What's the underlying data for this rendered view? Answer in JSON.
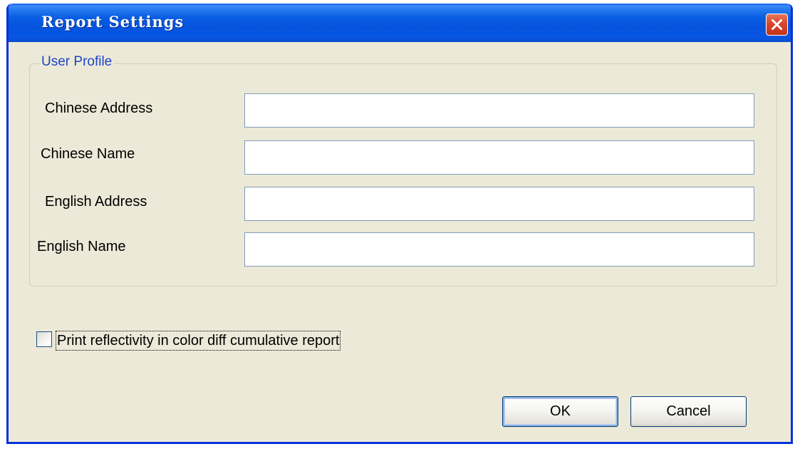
{
  "window": {
    "title": "Report Settings"
  },
  "group": {
    "legend": "User Profile",
    "fields": [
      {
        "label": "Chinese Address",
        "value": ""
      },
      {
        "label": "Chinese Name",
        "value": ""
      },
      {
        "label": "English Address",
        "value": ""
      },
      {
        "label": "English Name",
        "value": ""
      }
    ]
  },
  "options": {
    "print_reflectivity_label": "Print reflectivity in color diff cumulative report",
    "print_reflectivity_checked": false
  },
  "buttons": {
    "ok_label": "OK",
    "cancel_label": "Cancel"
  },
  "icons": {
    "close": "close-icon"
  },
  "colors": {
    "titlebar": "#0553dc",
    "window_bg": "#ece9d8",
    "legend_text": "#1f45c7",
    "close_button": "#d9472b"
  }
}
